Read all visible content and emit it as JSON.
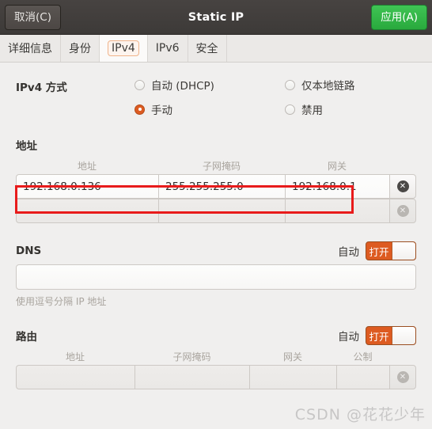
{
  "window": {
    "title": "Static IP",
    "cancel_label": "取消(C)",
    "apply_label": "应用(A)"
  },
  "tabs": [
    {
      "label": "详细信息",
      "active": false
    },
    {
      "label": "身份",
      "active": false
    },
    {
      "label": "IPv4",
      "active": true
    },
    {
      "label": "IPv6",
      "active": false
    },
    {
      "label": "安全",
      "active": false
    }
  ],
  "method": {
    "title": "IPv4 方式",
    "options": [
      {
        "label": "自动 (DHCP)",
        "selected": false
      },
      {
        "label": "仅本地链路",
        "selected": false
      },
      {
        "label": "手动",
        "selected": true
      },
      {
        "label": "禁用",
        "selected": false
      }
    ]
  },
  "addresses": {
    "title": "地址",
    "columns": [
      "地址",
      "子网掩码",
      "网关"
    ],
    "rows": [
      {
        "address": "192.168.0.136",
        "netmask": "255.255.255.0",
        "gateway": "192.168.0.1",
        "deletable": true
      },
      {
        "address": "",
        "netmask": "",
        "gateway": "",
        "deletable": false
      }
    ],
    "delete_icon": "close-circle-icon"
  },
  "dns": {
    "title": "DNS",
    "auto_label": "自动",
    "switch_state": "打开",
    "value": "",
    "hint": "使用逗号分隔 IP 地址"
  },
  "routes": {
    "title": "路由",
    "auto_label": "自动",
    "switch_state": "打开",
    "columns": [
      "地址",
      "子网掩码",
      "网关",
      "公制"
    ],
    "rows": [
      {
        "address": "",
        "netmask": "",
        "gateway": "",
        "metric": "",
        "deletable": false
      }
    ]
  },
  "watermark": "CSDN @花花少年",
  "colors": {
    "accent_orange": "#dd5b21",
    "apply_green": "#29a93d",
    "titlebar": "#413d3b",
    "background": "#f0efee",
    "annotation_red": "#e81b1b"
  }
}
